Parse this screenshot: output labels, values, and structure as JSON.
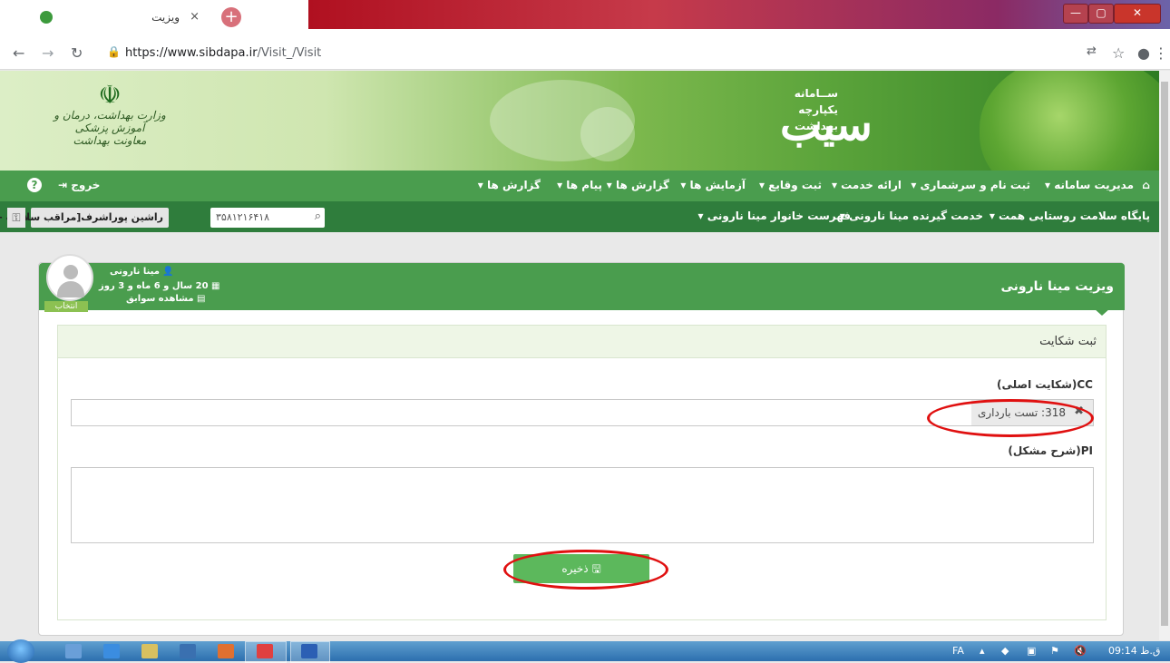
{
  "browser": {
    "tab_title": "ویزیت",
    "tab_close": "×",
    "new_tab": "+",
    "url_host": "https://www.sibdapa.ir",
    "url_path": "/Visit_/Visit",
    "window_buttons": [
      "—",
      "▢",
      "✕"
    ]
  },
  "banner": {
    "ministry_line1": "وزارت بهداشت، درمان و آموزش پزشکی",
    "ministry_line2": "معاونت بهداشت",
    "sib_lines": [
      "ســامانه",
      "یکپارچه",
      "بهداشت"
    ],
    "sib_word": "سیب"
  },
  "menu1": {
    "items": [
      "مدیریت سامانه ▾",
      "ثبت نام و سرشماری ▾",
      "ارائه خدمت ▾",
      "ثبت وقایع ▾",
      "آزمایش ها ▾",
      "گزارش ها ▾",
      "پیام ها ▾",
      "گزارش ها ▾"
    ],
    "logout": "خروج"
  },
  "menu2": {
    "items": [
      "پایگاه سلامت روستایی همت ▾",
      "خدمت گیرنده مینا نارونی ▾",
      "فهرست خانوار مینا نارونی ▾"
    ],
    "search_value": "۳۵۸۱۲۱۶۴۱۸",
    "user": "راشین پوراشرف[مراقب سلامت -ماما] ▾"
  },
  "panel": {
    "title": "ویزیت مینا نارونی",
    "patient_name": "مینا نارونی",
    "patient_age": "20 سال و 6 ماه و 3 روز",
    "history_link": "مشاهده سوابق",
    "pick_image": "انتخاب تصویر",
    "section_title": "ثبت شکایت",
    "cc_label": "CC(شکایت اصلی)",
    "cc_tag": "318: تست بارداری",
    "pi_label": "PI(شرح مشکل)",
    "pi_value": "",
    "save_label": "ذخیره"
  },
  "taskbar": {
    "lang": "FA",
    "time": "09:14 ق.ظ"
  },
  "colors": {
    "menu_green": "#4a9d4e",
    "submenu_green": "#2f7d3c",
    "save_green": "#5cb85c",
    "highlight_red": "#e01010"
  }
}
